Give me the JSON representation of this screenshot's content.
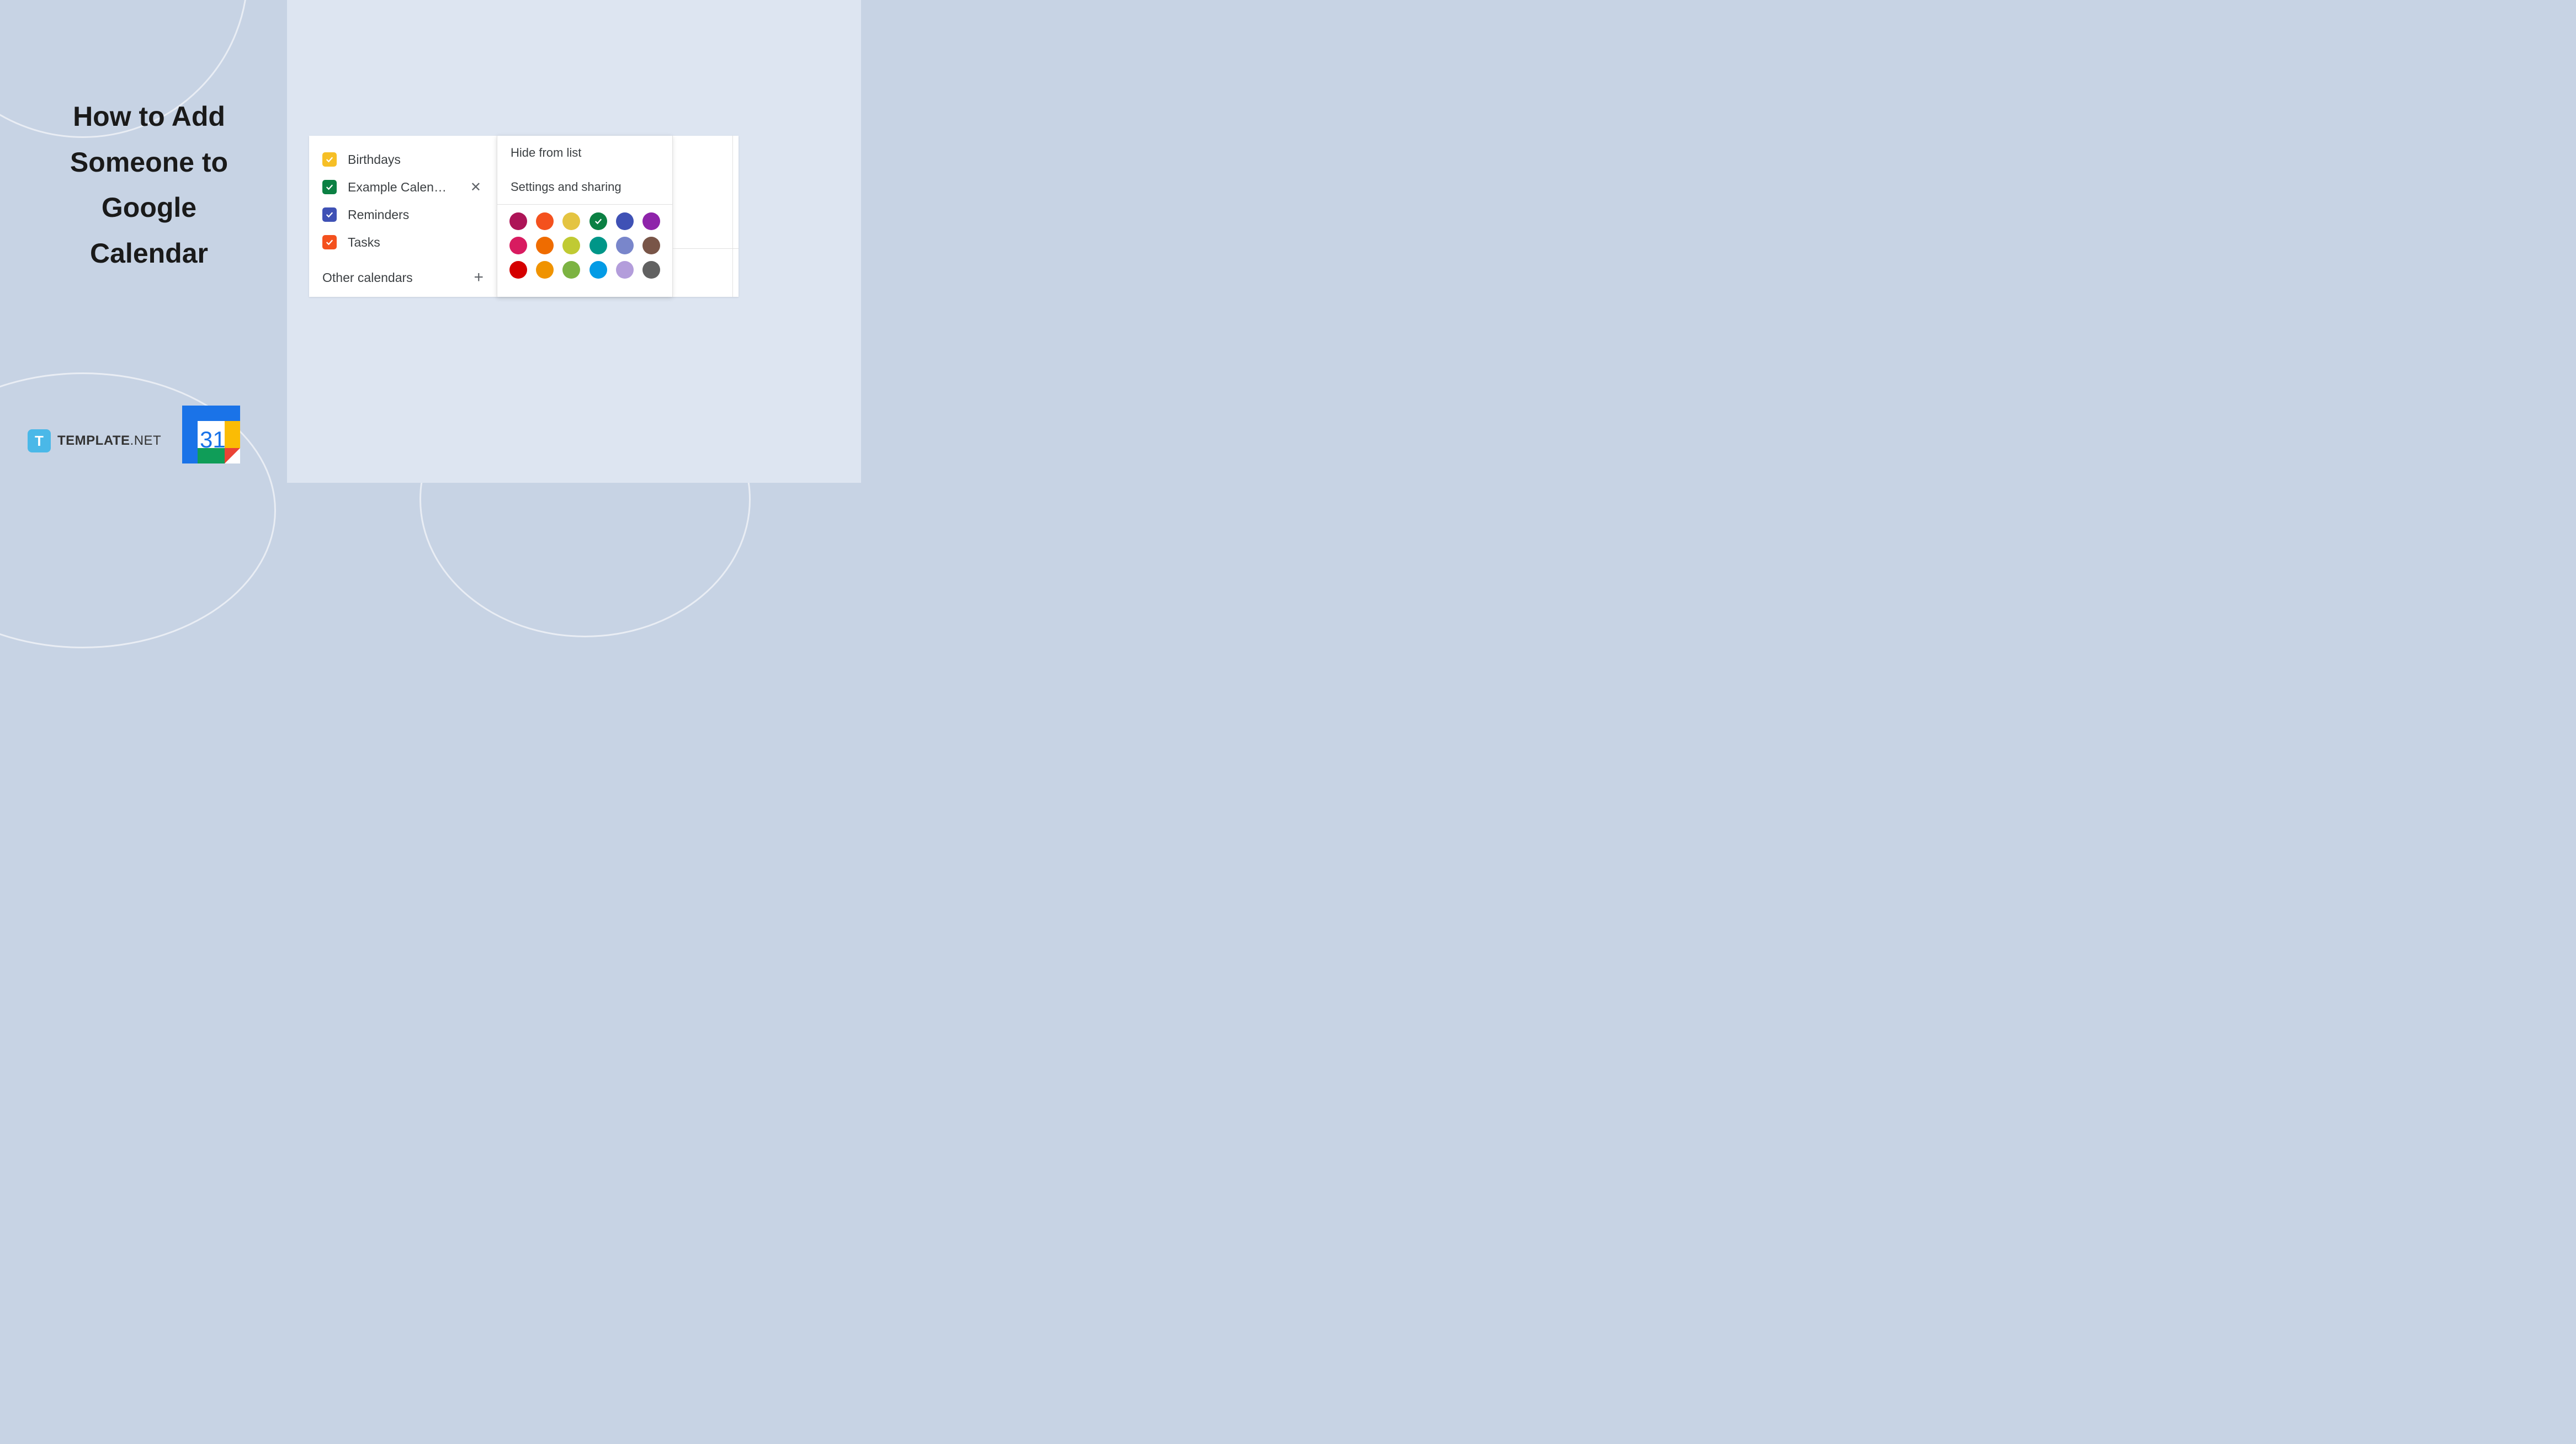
{
  "title": "How to Add Someone to Google Calendar",
  "brand": {
    "icon_letter": "T",
    "name": "TEMPLATE",
    "suffix": ".NET"
  },
  "app_icon": {
    "number": "31"
  },
  "calendar_list": {
    "items": [
      {
        "label": "Birthdays",
        "color": "#f6bf26",
        "checked": true,
        "hover": false
      },
      {
        "label": "Example Calen…",
        "color": "#0b8043",
        "checked": true,
        "hover": true
      },
      {
        "label": "Reminders",
        "color": "#3f51b5",
        "checked": true,
        "hover": false
      },
      {
        "label": "Tasks",
        "color": "#f4511e",
        "checked": true,
        "hover": false
      }
    ],
    "other_label": "Other calendars"
  },
  "context_menu": {
    "hide": "Hide from list",
    "settings": "Settings and sharing",
    "colors": [
      "#ad1457",
      "#f4511e",
      "#e4c441",
      "#0b8043",
      "#3f51b5",
      "#8e24aa",
      "#d81b60",
      "#ef6c00",
      "#c0ca33",
      "#009688",
      "#7986cb",
      "#795548",
      "#d50000",
      "#f09300",
      "#7cb342",
      "#039be5",
      "#b39ddb",
      "#616161"
    ],
    "selected_index": 3
  }
}
